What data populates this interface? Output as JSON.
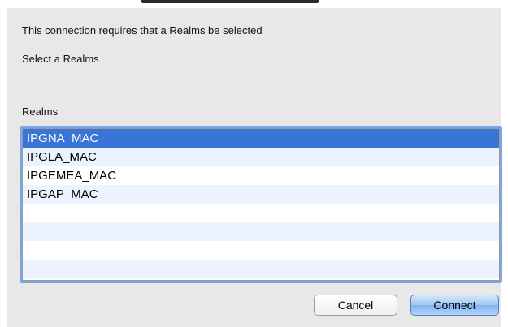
{
  "dialog": {
    "message": "This connection requires that a Realms be selected",
    "prompt": "Select a Realms",
    "list_label": "Realms"
  },
  "realms": {
    "selected_index": 0,
    "items": [
      {
        "label": "IPGNA_MAC"
      },
      {
        "label": "IPGLA_MAC"
      },
      {
        "label": "IPGEMEA_MAC"
      },
      {
        "label": "IPGAP_MAC"
      }
    ]
  },
  "buttons": {
    "cancel_label": "Cancel",
    "connect_label": "Connect"
  },
  "colors": {
    "selection": "#3875d7",
    "alt_row": "#edf3fe",
    "focus_ring": "#7aa7e0",
    "default_button": "#9fc7f2"
  }
}
